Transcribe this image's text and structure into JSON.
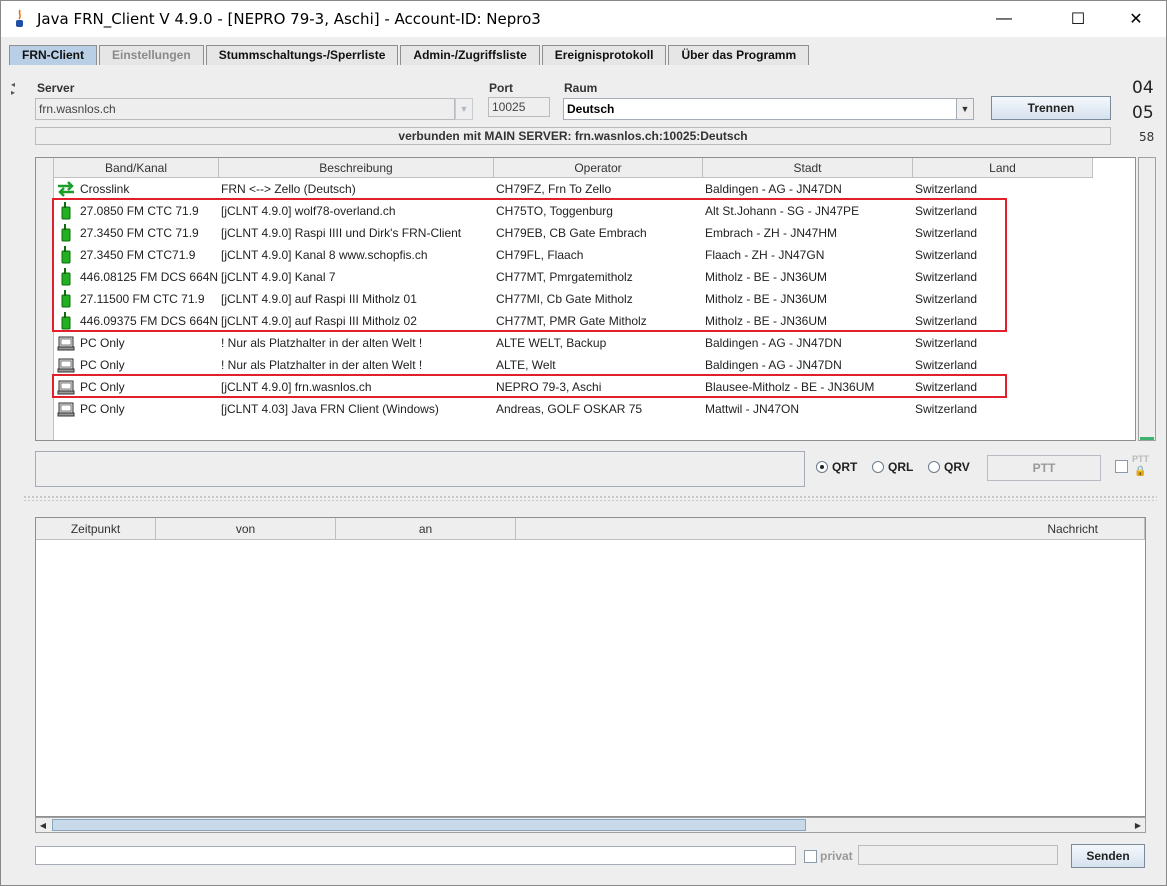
{
  "window": {
    "title": "Java FRN_Client V 4.9.0 - [NEPRO 79-3, Aschi] - Account-ID: Nepro3",
    "minimize": "—",
    "maximize": "☐",
    "close": "✕"
  },
  "tabs": [
    {
      "label": "FRN-Client",
      "state": "active"
    },
    {
      "label": "Einstellungen",
      "state": "disabled"
    },
    {
      "label": "Stummschaltungs-/Sperrliste",
      "state": "normal"
    },
    {
      "label": "Admin-/Zugriffsliste",
      "state": "normal"
    },
    {
      "label": "Ereignisprotokoll",
      "state": "normal"
    },
    {
      "label": "Über das Programm",
      "state": "normal"
    }
  ],
  "connection": {
    "server_label": "Server",
    "server_value": "frn.wasnlos.ch",
    "port_label": "Port",
    "port_value": "10025",
    "room_label": "Raum",
    "room_value": "Deutsch",
    "disconnect_button": "Trennen",
    "status_text": "verbunden mit  MAIN SERVER: frn.wasnlos.ch:10025:Deutsch"
  },
  "clock": {
    "hours": "04",
    "minutes": "05",
    "seconds": "58"
  },
  "clients_table": {
    "columns": [
      "Band/Kanal",
      "Beschreibung",
      "Operator",
      "Stadt",
      "Land"
    ],
    "rows": [
      {
        "icon": "crosslink-icon",
        "band": "Crosslink",
        "desc": "FRN <--> Zello (Deutsch)",
        "operator": "CH79FZ, Frn To Zello",
        "city": "Baldingen - AG - JN47DN",
        "country": "Switzerland"
      },
      {
        "icon": "radio-gateway-icon",
        "band": "27.0850 FM CTC 71.9",
        "desc": "[jCLNT 4.9.0] wolf78-overland.ch",
        "operator": "CH75TO, Toggenburg",
        "city": "Alt St.Johann - SG - JN47PE",
        "country": "Switzerland"
      },
      {
        "icon": "radio-gateway-icon",
        "band": "27.3450 FM CTC 71.9",
        "desc": "[jCLNT 4.9.0]  Raspi IIII und Dirk's FRN-Client",
        "operator": "CH79EB, CB Gate Embrach",
        "city": "Embrach - ZH - JN47HM",
        "country": "Switzerland"
      },
      {
        "icon": "radio-gateway-icon",
        "band": "27.3450 FM CTC71.9",
        "desc": "[jCLNT 4.9.0]   Kanal 8  www.schopfis.ch",
        "operator": "CH79FL, Flaach",
        "city": "Flaach - ZH - JN47GN",
        "country": "Switzerland"
      },
      {
        "icon": "radio-gateway-icon",
        "band": "446.08125 FM DCS 664N",
        "desc": "[jCLNT 4.9.0] Kanal 7",
        "operator": "CH77MT, Pmrgatemitholz",
        "city": "Mitholz - BE - JN36UM",
        "country": "Switzerland"
      },
      {
        "icon": "radio-gateway-icon",
        "band": "27.11500 FM CTC 71.9",
        "desc": "[jCLNT 4.9.0]  auf Raspi III  Mitholz 01",
        "operator": "CH77MI, Cb Gate Mitholz",
        "city": "Mitholz - BE - JN36UM",
        "country": "Switzerland"
      },
      {
        "icon": "radio-gateway-icon",
        "band": "446.09375 FM DCS 664N",
        "desc": "[jCLNT 4.9.0]  auf Raspi III  Mitholz 02",
        "operator": "CH77MT, PMR Gate Mitholz",
        "city": "Mitholz - BE - JN36UM",
        "country": "Switzerland"
      },
      {
        "icon": "pc-icon",
        "band": "PC Only",
        "desc": "! Nur als Platzhalter in der alten Welt !",
        "operator": "ALTE WELT, Backup",
        "city": "Baldingen - AG - JN47DN",
        "country": "Switzerland"
      },
      {
        "icon": "pc-icon",
        "band": "PC Only",
        "desc": "! Nur als Platzhalter in der alten Welt !",
        "operator": "ALTE, Welt",
        "city": "Baldingen - AG - JN47DN",
        "country": "Switzerland"
      },
      {
        "icon": "pc-icon",
        "band": "PC Only",
        "desc": "[jCLNT 4.9.0] frn.wasnlos.ch",
        "operator": "NEPRO 79-3, Aschi",
        "city": "Blausee-Mitholz - BE - JN36UM",
        "country": "Switzerland"
      },
      {
        "icon": "pc-icon",
        "band": "PC Only",
        "desc": "[jCLNT 4.03] Java FRN Client (Windows)",
        "operator": "Andreas, GOLF OSKAR 75",
        "city": "Mattwil - JN47ON",
        "country": "Switzerland"
      }
    ]
  },
  "transmit": {
    "options": [
      {
        "label": "QRT",
        "selected": true
      },
      {
        "label": "QRL",
        "selected": false
      },
      {
        "label": "QRV",
        "selected": false
      }
    ],
    "ptt_button": "PTT",
    "ptt_lock_label": "PTT"
  },
  "chat_table": {
    "columns": [
      "Zeitpunkt",
      "von",
      "an",
      "Nachricht"
    ],
    "rows": []
  },
  "chat_input": {
    "value": "",
    "private_label": "privat",
    "send_button": "Senden"
  },
  "colors": {
    "highlight": "#e0212b",
    "active_tab": "#b8cfe5",
    "level_bar": "#3cb371"
  }
}
